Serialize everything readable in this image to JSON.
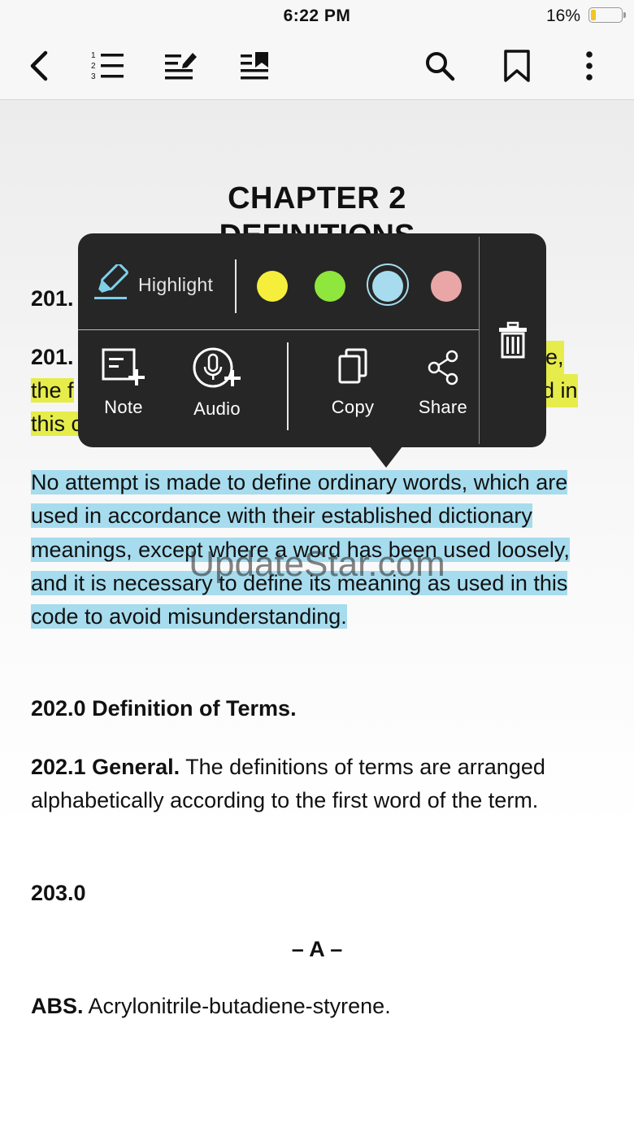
{
  "status_bar": {
    "time": "6:22 PM",
    "battery_percent": "16%",
    "battery_level": 0.16
  },
  "toolbar": {
    "icons": [
      "back-icon",
      "table-of-contents-icon",
      "annotations-icon",
      "bookmarks-list-icon",
      "search-icon",
      "bookmark-icon",
      "more-icon"
    ]
  },
  "document": {
    "chapter_title": "CHAPTER 2",
    "chapter_subtitle": "DEFINITIONS",
    "section_201_partial": "201.",
    "section_201_1_number": "201.",
    "hidden_line_1_end": "e,",
    "hidden_line_2_start": "the f",
    "hidden_line_2_end": "d in",
    "hidden_line_3_start": "this c",
    "highlighted_paragraph": "No attempt is made to define ordinary words, which are used in accordance with their established dictionary meanings, except where a word has been used loosely, and it is necessary to define its meaning as used in this code to avoid misunderstanding.",
    "section_202_heading": "202.0 Definition of Terms.",
    "section_202_1_heading": "202.1 General.",
    "section_202_1_text": " The definitions of terms are arranged alphabetically according to the first word of the term.",
    "section_203_heading": "203.0",
    "letter_divider": "– A –",
    "abs_term": "ABS.",
    "abs_definition": " Acrylonitrile-butadiene-styrene."
  },
  "popup": {
    "highlight_label": "Highlight",
    "colors": [
      {
        "name": "yellow",
        "hex": "#f5ef3c"
      },
      {
        "name": "green",
        "hex": "#8fe63c"
      },
      {
        "name": "blue",
        "hex": "#a6dcee",
        "selected": true
      },
      {
        "name": "pink",
        "hex": "#eaa6a6"
      }
    ],
    "actions": [
      {
        "label": "Note",
        "icon": "note-add-icon"
      },
      {
        "label": "Audio",
        "icon": "audio-add-icon"
      },
      {
        "label": "Copy",
        "icon": "copy-icon"
      },
      {
        "label": "Share",
        "icon": "share-icon"
      }
    ],
    "delete_icon": "trash-icon"
  },
  "watermark": "UpdateStar.com"
}
